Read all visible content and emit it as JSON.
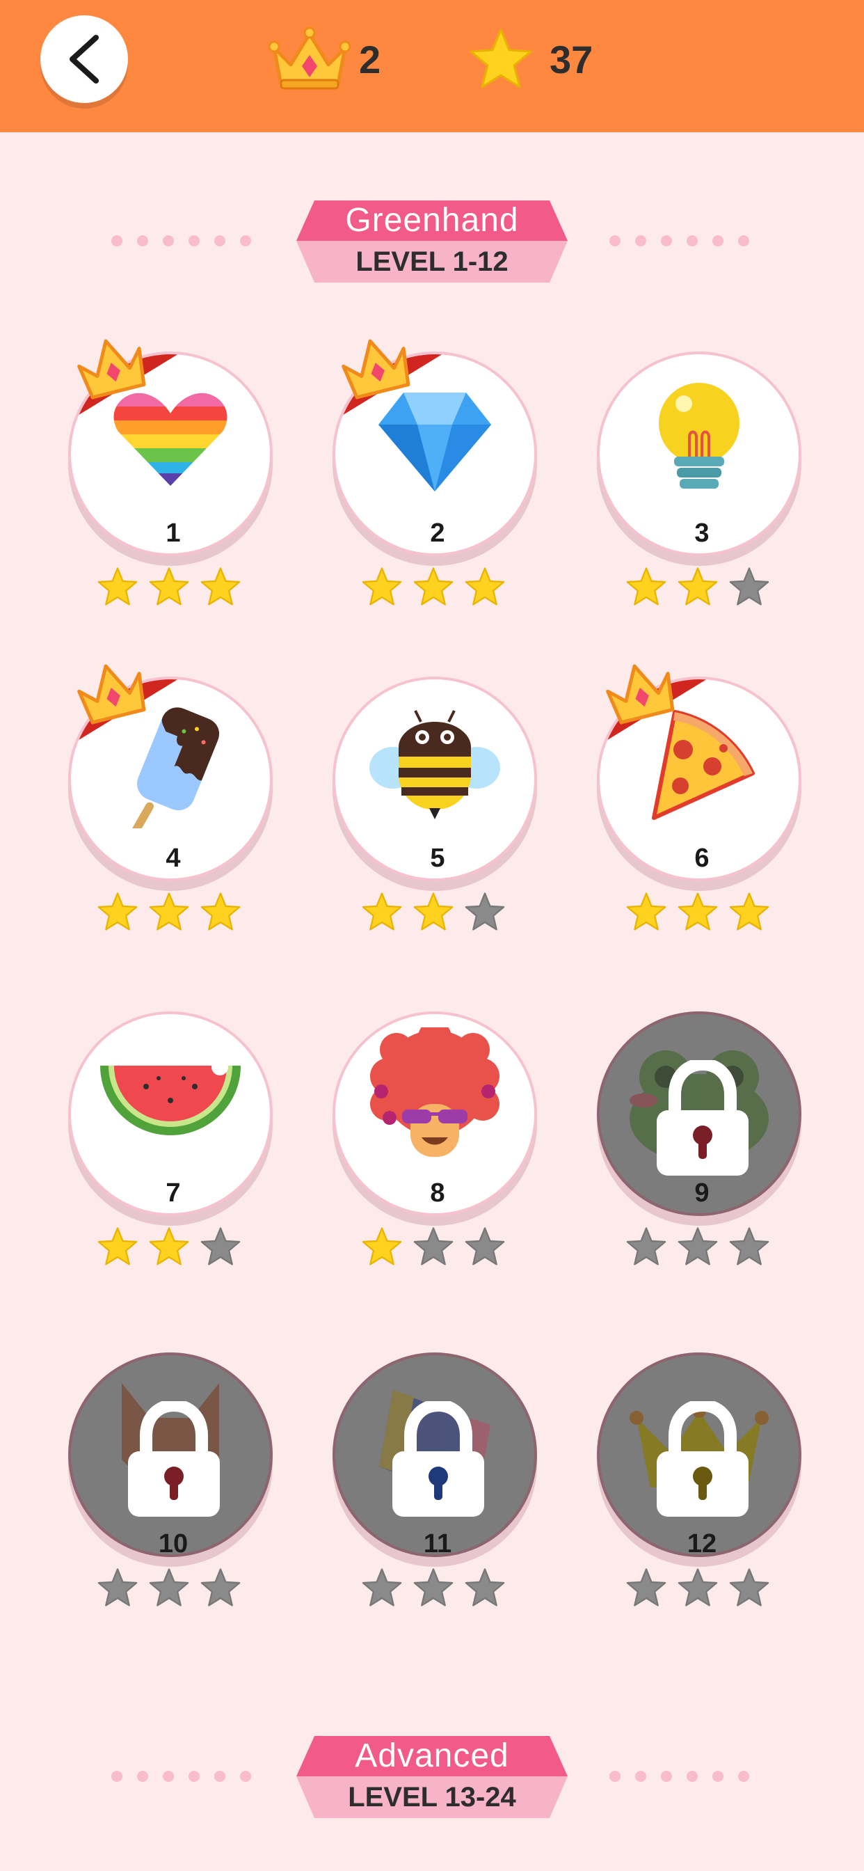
{
  "topbar": {
    "back_icon": "back-arrow-icon",
    "crowns": {
      "icon": "crown-icon",
      "value": "2"
    },
    "stars": {
      "icon": "star-icon",
      "value": "37"
    }
  },
  "sections": [
    {
      "title": "Greenhand",
      "range": "LEVEL 1-12"
    },
    {
      "title": "Advanced",
      "range": "LEVEL 13-24"
    }
  ],
  "levels": [
    {
      "number": "1",
      "icon": "rainbow-heart-icon",
      "stars": 3,
      "crowned": true,
      "locked": false
    },
    {
      "number": "2",
      "icon": "diamond-icon",
      "stars": 3,
      "crowned": true,
      "locked": false
    },
    {
      "number": "3",
      "icon": "light-bulb-icon",
      "stars": 2,
      "crowned": false,
      "locked": false
    },
    {
      "number": "4",
      "icon": "ice-pop-icon",
      "stars": 3,
      "crowned": true,
      "locked": false
    },
    {
      "number": "5",
      "icon": "bee-icon",
      "stars": 2,
      "crowned": false,
      "locked": false
    },
    {
      "number": "6",
      "icon": "pizza-slice-icon",
      "stars": 3,
      "crowned": true,
      "locked": false
    },
    {
      "number": "7",
      "icon": "watermelon-icon",
      "stars": 2,
      "crowned": false,
      "locked": false
    },
    {
      "number": "8",
      "icon": "afro-face-icon",
      "stars": 1,
      "crowned": false,
      "locked": false
    },
    {
      "number": "9",
      "icon": "frog-icon",
      "stars": 0,
      "crowned": false,
      "locked": true
    },
    {
      "number": "10",
      "icon": "fox-icon",
      "stars": 0,
      "crowned": false,
      "locked": true
    },
    {
      "number": "11",
      "icon": "book-icon",
      "stars": 0,
      "crowned": false,
      "locked": true
    },
    {
      "number": "12",
      "icon": "crown-icon",
      "stars": 0,
      "crowned": false,
      "locked": true
    }
  ],
  "colors": {
    "topbar": "#ff8840",
    "background": "#fdeaea",
    "ribbon_top": "#f25a8a",
    "ribbon_bottom": "#f7b3c8",
    "star_filled": "#ffd21f",
    "star_empty": "#8a8a8a",
    "locked_disc": "#7c7c7c",
    "crown_banner": "#d0261f"
  }
}
